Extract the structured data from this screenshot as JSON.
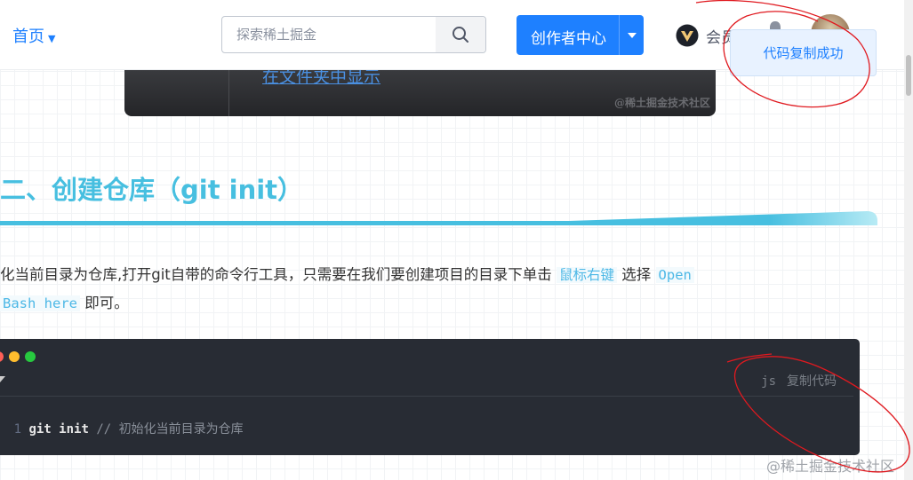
{
  "header": {
    "nav_home": "首页",
    "search_placeholder": "探索稀土掘金",
    "creator_button": "创作者中心",
    "vip_label": "会员"
  },
  "toast": {
    "message": "代码复制成功"
  },
  "article": {
    "image_link_text": "在文件夹中显示",
    "image_watermark": "@稀土掘金技术社区",
    "heading": "二、创建仓库（git init）",
    "para_1": "化当前目录为仓库,打开git自带的命令行工具，只需要在我们要创建项目的目录下单击 ",
    "para_code_1": "鼠标右键",
    "para_2": " 选择 ",
    "para_code_2": "Open",
    "para_code_3": "Bash here",
    "para_3": " 即可。"
  },
  "code_block": {
    "language": "js",
    "copy_label": "复制代码",
    "line_number": "1",
    "command": "git init",
    "comment": "// 初始化当前目录为仓库"
  },
  "watermark": "@稀土掘金技术社区",
  "colors": {
    "accent": "#1e80ff",
    "heading": "#47bfe0",
    "code_bg": "#282c34",
    "annotation": "#e0191f"
  }
}
